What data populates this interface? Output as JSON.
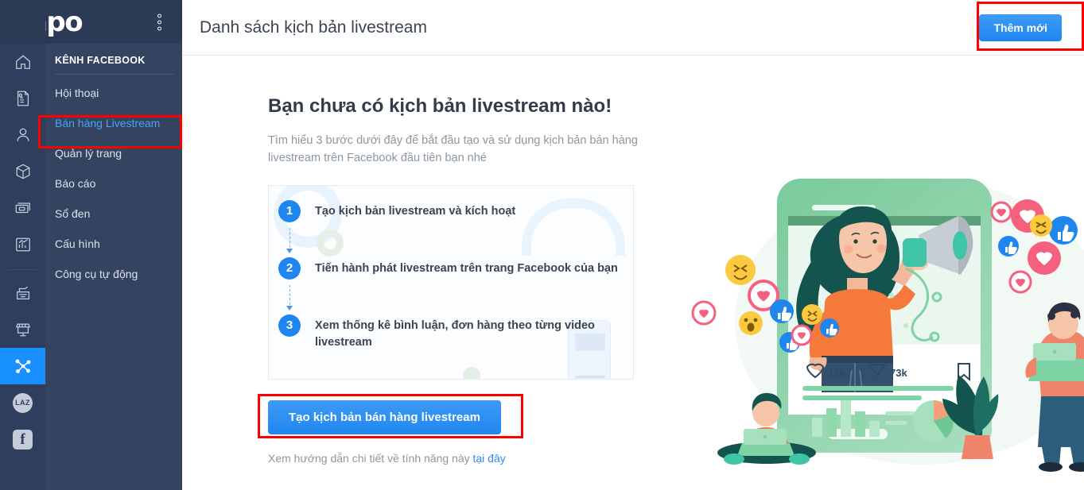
{
  "brand": {
    "logo_text": "Sapo",
    "kebab_icon": "kebab-menu-icon"
  },
  "sidebar": {
    "section_title": "KÊNH FACEBOOK",
    "items": [
      {
        "label": "Hội thoại",
        "active": false
      },
      {
        "label": "Bán hàng Livestream",
        "active": true
      },
      {
        "label": "Quản lý trang",
        "active": false
      },
      {
        "label": "Báo cáo",
        "active": false
      },
      {
        "label": "Sổ đen",
        "active": false
      },
      {
        "label": "Cấu hình",
        "active": false
      },
      {
        "label": "Công cụ tự động",
        "active": false
      }
    ]
  },
  "icon_rail": {
    "icons": [
      "home-icon",
      "invoice-icon",
      "customer-icon",
      "product-box-icon",
      "cash-icon",
      "report-chart-icon",
      "pos-register-icon",
      "storefront-icon",
      "omnichannel-icon",
      "lazada-icon",
      "facebook-icon"
    ],
    "active_icon": "omnichannel-icon",
    "lazada_label": "LAZ",
    "facebook_label": "f"
  },
  "header": {
    "title": "Danh sách kịch bản livestream",
    "add_button": "Thêm mới"
  },
  "empty_state": {
    "heading": "Bạn chưa có kịch bản livestream nào!",
    "subtitle": "Tìm hiểu 3 bước dưới đây để bắt đầu tạo và sử dụng kịch bản bán hàng livestream trên Facebook đầu tiên bạn nhé",
    "steps": [
      {
        "number": "1",
        "text": "Tạo kịch bản livestream và kích hoạt"
      },
      {
        "number": "2",
        "text": "Tiến hành phát livestream trên trang Facebook của bạn"
      },
      {
        "number": "3",
        "text": "Xem thống kê bình luận, đơn hàng theo từng video livestream"
      }
    ],
    "cta_button": "Tạo kịch bản bán hàng livestream",
    "footer_text": "Xem hướng dẫn chi tiết về tính năng này ",
    "footer_link": "tại đây"
  },
  "illustration": {
    "name": "livestream-selling-illustration",
    "likes_count": "13k",
    "shares_count": "73k"
  },
  "colors": {
    "sidebar_bg": "#34435f",
    "rail_bg": "#2e3e5c",
    "brand_bg": "#2b3a55",
    "accent_blue": "#1f86f0",
    "active_text": "#4aa3f0",
    "annotation_red": "#ff0000"
  }
}
